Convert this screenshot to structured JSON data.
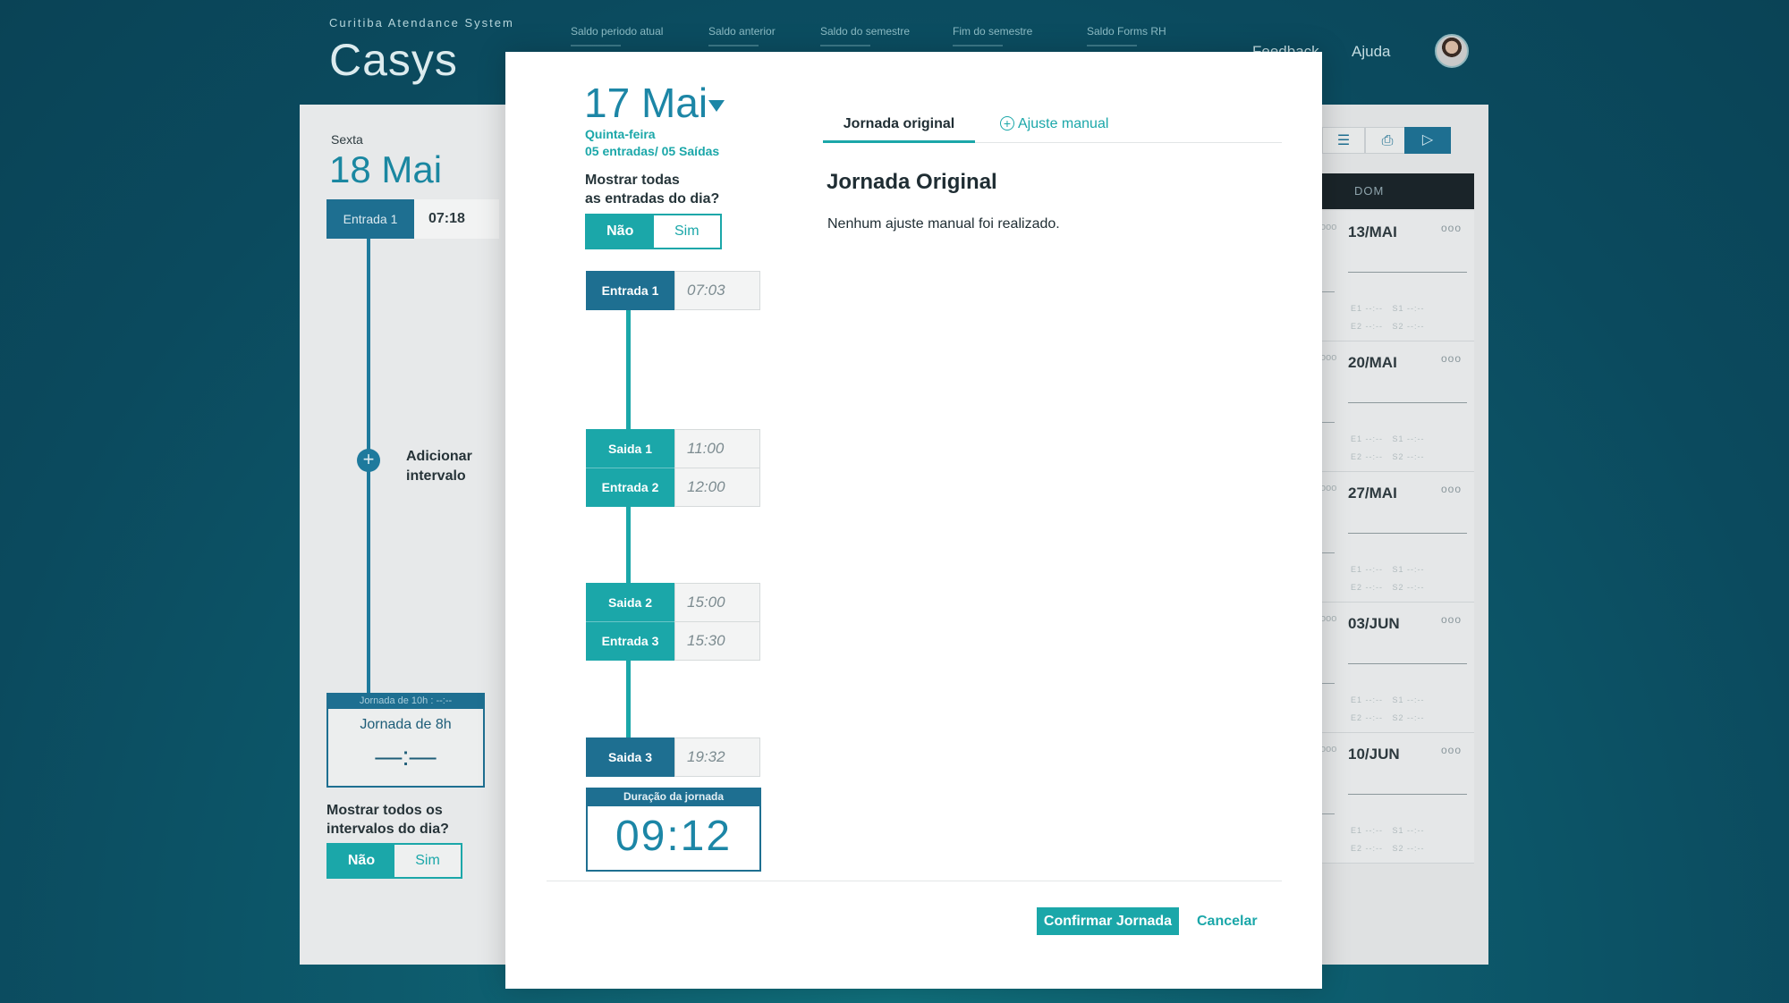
{
  "app": {
    "subtitle": "Curitiba Atendance System",
    "title": "Casys",
    "header_stats": [
      "Saldo periodo atual",
      "Saldo anterior",
      "Saldo do semestre",
      "Fim do semestre",
      "Saldo Forms RH"
    ],
    "links": {
      "feedback": "Feedback",
      "help": "Ajuda"
    }
  },
  "left_panel": {
    "day_name": "Sexta",
    "date": "18 Mai",
    "entry_label": "Entrada 1",
    "entry_time": "07:18",
    "add_interval": [
      "Adicionar",
      "intervalo"
    ],
    "jornada_header": "Jornada de 10h : --:--",
    "jornada_label": "Jornada de 8h",
    "jornada_value": "—:—",
    "show_intervals": [
      "Mostrar todos os",
      "intervalos do dia?"
    ],
    "toggle": {
      "no": "Não",
      "yes": "Sim"
    }
  },
  "right_panel": {
    "day_header": "DOM",
    "weeks": [
      "13/MAI",
      "20/MAI",
      "27/MAI",
      "03/JUN",
      "10/JUN"
    ],
    "dots": "ooo",
    "mini_rows": [
      [
        "E1 --:--",
        "S1 --:--"
      ],
      [
        "E2 --:--",
        "S2 --:--"
      ]
    ]
  },
  "modal": {
    "date": "17 Mai",
    "weekday": "Quinta-feira",
    "counts": "05 entradas/ 05 Saídas",
    "show_all": [
      "Mostrar todas",
      "as entradas do dia?"
    ],
    "toggle": {
      "no": "Não",
      "yes": "Sim"
    },
    "timeline": [
      {
        "label": "Entrada 1",
        "time": "07:03"
      },
      {
        "label": "Saida 1",
        "time": "11:00"
      },
      {
        "label": "Entrada 2",
        "time": "12:00"
      },
      {
        "label": "Saida 2",
        "time": "15:00"
      },
      {
        "label": "Entrada 3",
        "time": "15:30"
      },
      {
        "label": "Saida 3",
        "time": "19:32"
      }
    ],
    "duration_label": "Duração da jornada",
    "duration_value": "09:12",
    "tabs": {
      "original": "Jornada original",
      "manual": "Ajuste manual"
    },
    "section_title": "Jornada Original",
    "message": "Nenhum ajuste manual foi realizado.",
    "confirm": "Confirmar Jornada",
    "cancel": "Cancelar"
  },
  "colors": {
    "teal": "#1ba7a9",
    "dark_blue": "#1e6f91",
    "date_blue": "#1c86a6"
  }
}
